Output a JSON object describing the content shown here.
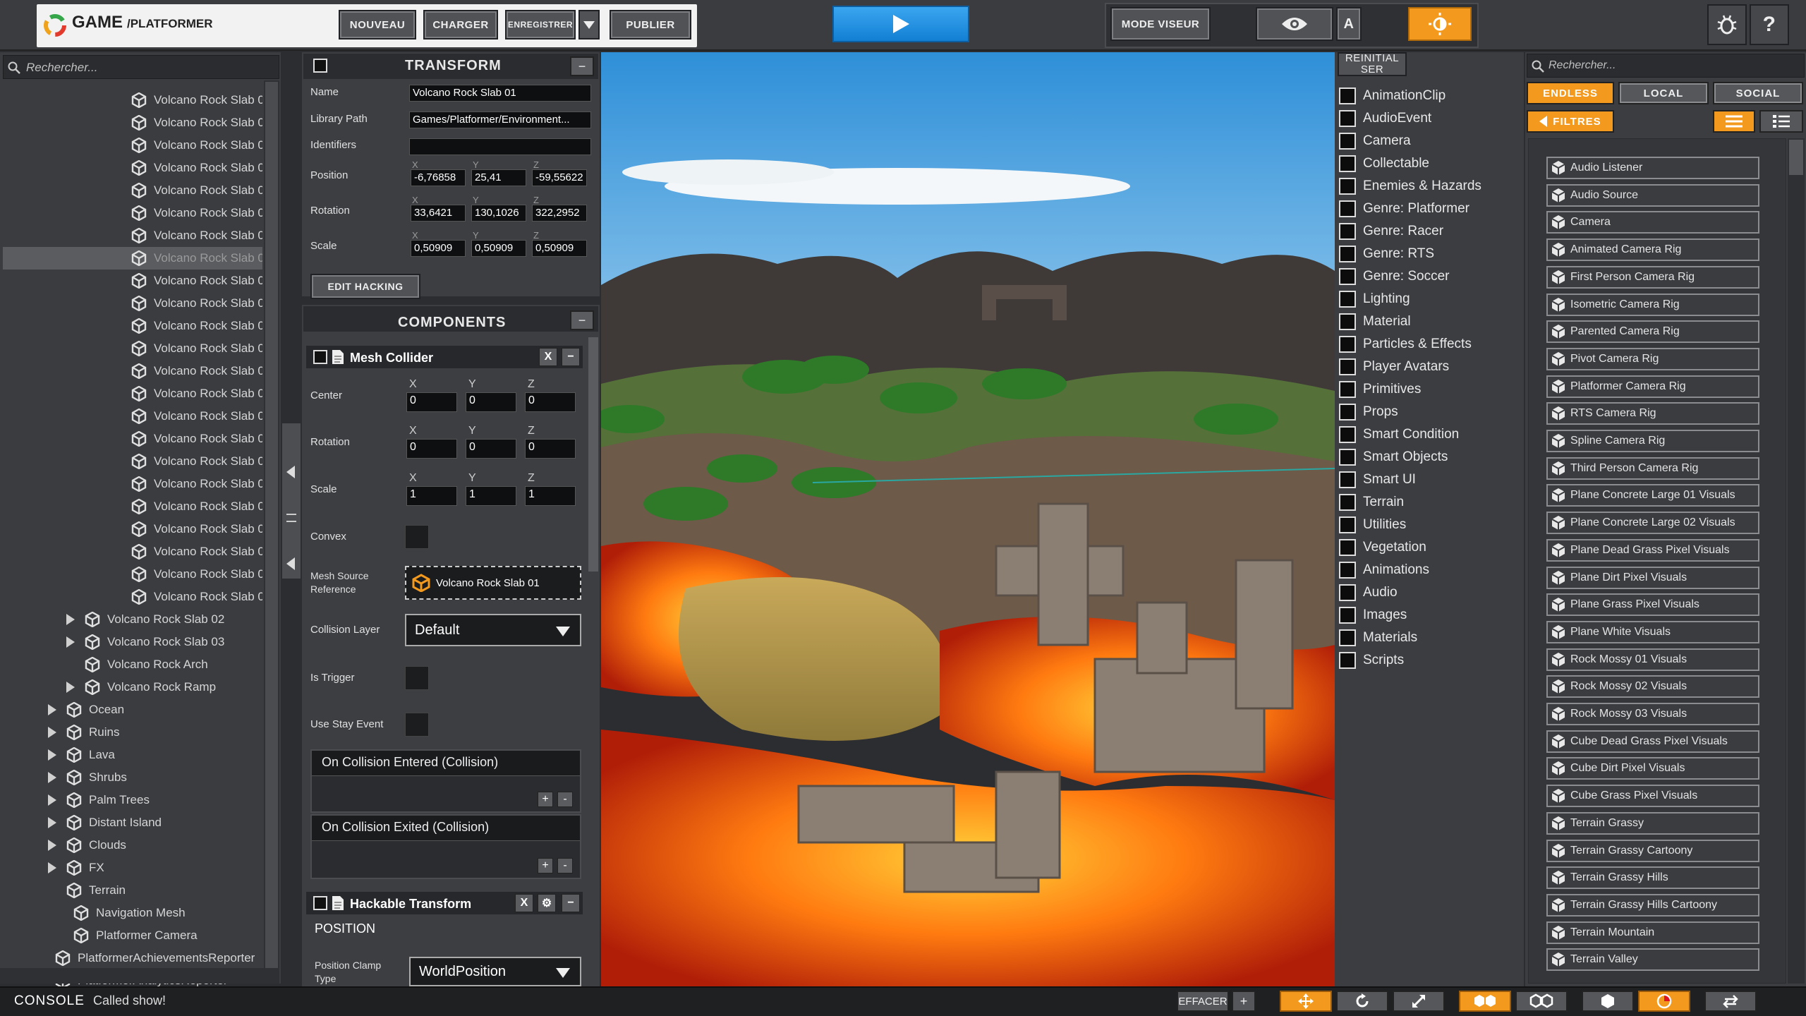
{
  "app": {
    "name": "GAME",
    "subtitle": "/PLATFORMER"
  },
  "toolbar": {
    "nouveau": "NOUVEAU",
    "charger": "CHARGER",
    "enregistrer": "ENREGISTRER",
    "publier": "PUBLIER",
    "mode_viseur": "MODE VISEUR",
    "a_label": "A"
  },
  "colors": {
    "accent_orange": "#f39a1e",
    "play_blue": "#1b8fe0",
    "panel_bg": "#3c3e42"
  },
  "hierarchy": {
    "search_placeholder": "Rechercher...",
    "items": [
      {
        "label": "Volcano Rock Slab 0",
        "level": 2,
        "arrow": false
      },
      {
        "label": "Volcano Rock Slab 0",
        "level": 2,
        "arrow": false
      },
      {
        "label": "Volcano Rock Slab 0",
        "level": 2,
        "arrow": false
      },
      {
        "label": "Volcano Rock Slab 0",
        "level": 2,
        "arrow": false
      },
      {
        "label": "Volcano Rock Slab 0",
        "level": 2,
        "arrow": false
      },
      {
        "label": "Volcano Rock Slab 0",
        "level": 2,
        "arrow": false
      },
      {
        "label": "Volcano Rock Slab 0",
        "level": 2,
        "arrow": false
      },
      {
        "label": "Volcano Rock Slab 0",
        "level": 2,
        "arrow": false,
        "selected": true
      },
      {
        "label": "Volcano Rock Slab 0",
        "level": 2,
        "arrow": false
      },
      {
        "label": "Volcano Rock Slab 0",
        "level": 2,
        "arrow": false
      },
      {
        "label": "Volcano Rock Slab 0",
        "level": 2,
        "arrow": false
      },
      {
        "label": "Volcano Rock Slab 0",
        "level": 2,
        "arrow": false
      },
      {
        "label": "Volcano Rock Slab 0",
        "level": 2,
        "arrow": false
      },
      {
        "label": "Volcano Rock Slab 0",
        "level": 2,
        "arrow": false
      },
      {
        "label": "Volcano Rock Slab 0",
        "level": 2,
        "arrow": false
      },
      {
        "label": "Volcano Rock Slab 0",
        "level": 2,
        "arrow": false
      },
      {
        "label": "Volcano Rock Slab 0",
        "level": 2,
        "arrow": false
      },
      {
        "label": "Volcano Rock Slab 0",
        "level": 2,
        "arrow": false
      },
      {
        "label": "Volcano Rock Slab 0",
        "level": 2,
        "arrow": false
      },
      {
        "label": "Volcano Rock Slab 0",
        "level": 2,
        "arrow": false
      },
      {
        "label": "Volcano Rock Slab 0",
        "level": 2,
        "arrow": false
      },
      {
        "label": "Volcano Rock Slab 0",
        "level": 2,
        "arrow": false
      },
      {
        "label": "Volcano Rock Slab 0",
        "level": 2,
        "arrow": false
      },
      {
        "label": "Volcano Rock Slab 02",
        "level": 1,
        "arrow": true
      },
      {
        "label": "Volcano Rock Slab 03",
        "level": 1,
        "arrow": true
      },
      {
        "label": "Volcano Rock Arch",
        "level": 1,
        "arrow": false
      },
      {
        "label": "Volcano Rock Ramp",
        "level": 1,
        "arrow": true
      },
      {
        "label": "Ocean",
        "level": 0,
        "arrow": true
      },
      {
        "label": "Ruins",
        "level": 0,
        "arrow": true
      },
      {
        "label": "Lava",
        "level": 0,
        "arrow": true
      },
      {
        "label": "Shrubs",
        "level": 0,
        "arrow": true
      },
      {
        "label": "Palm Trees",
        "level": 0,
        "arrow": true
      },
      {
        "label": "Distant Island",
        "level": 0,
        "arrow": true
      },
      {
        "label": "Clouds",
        "level": 0,
        "arrow": true
      },
      {
        "label": "FX",
        "level": 0,
        "arrow": true
      },
      {
        "label": "Terrain",
        "level": 0,
        "arrow": false
      },
      {
        "label": "Navigation Mesh",
        "level": -1,
        "arrow": false
      },
      {
        "label": "Platformer Camera",
        "level": -1,
        "arrow": false
      },
      {
        "label": "PlatformerAchievementsReporter",
        "level": -2,
        "arrow": false
      },
      {
        "label": "PlatformerAnalyticsReporter",
        "level": -2,
        "arrow": false
      }
    ]
  },
  "transform": {
    "title": "TRANSFORM",
    "name_label": "Name",
    "name_value": "Volcano Rock Slab 01",
    "library_label": "Library Path",
    "library_value": "Games/Platformer/Environment...",
    "identifiers_label": "Identifiers",
    "identifiers_value": "",
    "position_label": "Position",
    "rotation_label": "Rotation",
    "scale_label": "Scale",
    "axis_x": "X",
    "axis_y": "Y",
    "axis_z": "Z",
    "position": [
      "-6,76858",
      "25,41",
      "-59,55622"
    ],
    "rotation": [
      "33,6421",
      "130,1026",
      "322,2952"
    ],
    "scale": [
      "0,50909",
      "0,50909",
      "0,50909"
    ],
    "edit_hacking": "EDIT HACKING"
  },
  "components": {
    "title": "COMPONENTS",
    "mesh_collider": {
      "title": "Mesh Collider",
      "x_btn": "X",
      "center_label": "Center",
      "rotation_label": "Rotation",
      "scale_label": "Scale",
      "center": [
        "0",
        "0",
        "0"
      ],
      "rotation": [
        "0",
        "0",
        "0"
      ],
      "scale": [
        "1",
        "1",
        "1"
      ],
      "convex_label": "Convex",
      "mesh_source_label_1": "Mesh Source",
      "mesh_source_label_2": "Reference",
      "mesh_source_value": "Volcano Rock Slab 01",
      "collision_layer_label": "Collision Layer",
      "collision_layer_value": "Default",
      "is_trigger_label": "Is Trigger",
      "use_stay_label": "Use Stay Event",
      "on_enter": "On Collision Entered (Collision)",
      "on_exit": "On Collision Exited (Collision)",
      "plus": "+",
      "minus": "-"
    },
    "hackable": {
      "title": "Hackable Transform",
      "x_btn": "X",
      "position_header": "POSITION",
      "clamp_label_1": "Position Clamp",
      "clamp_label_2": "Type",
      "clamp_value": "WorldPosition"
    }
  },
  "types": {
    "reset_label_1": "REINITIAL",
    "reset_label_2": "SER",
    "items": [
      "AnimationClip",
      "AudioEvent",
      "Camera",
      "Collectable",
      "Enemies & Hazards",
      "Genre: Platformer",
      "Genre: Racer",
      "Genre: RTS",
      "Genre: Soccer",
      "Lighting",
      "Material",
      "Particles & Effects",
      "Player Avatars",
      "Primitives",
      "Props",
      "Smart Condition",
      "Smart Objects",
      "Smart UI",
      "Terrain",
      "Utilities",
      "Vegetation",
      "Animations",
      "Audio",
      "Images",
      "Materials",
      "Scripts"
    ]
  },
  "library": {
    "search_placeholder": "Rechercher...",
    "tab_endless": "ENDLESS",
    "tab_local": "LOCAL",
    "tab_social": "SOCIAL",
    "filters": "FILTRES",
    "items": [
      "Audio Listener",
      "Audio Source",
      "Camera",
      "Animated Camera Rig",
      "First Person Camera Rig",
      "Isometric Camera Rig",
      "Parented Camera Rig",
      "Pivot Camera Rig",
      "Platformer Camera Rig",
      "RTS Camera Rig",
      "Spline Camera Rig",
      "Third Person Camera Rig",
      "Plane Concrete Large 01 Visuals",
      "Plane Concrete Large 02 Visuals",
      "Plane Dead Grass Pixel Visuals",
      "Plane Dirt Pixel Visuals",
      "Plane Grass Pixel Visuals",
      "Plane White Visuals",
      "Rock Mossy 01 Visuals",
      "Rock Mossy 02 Visuals",
      "Rock Mossy 03 Visuals",
      "Cube Dead Grass Pixel Visuals",
      "Cube Dirt Pixel Visuals",
      "Cube Grass Pixel Visuals",
      "Terrain Grassy",
      "Terrain Grassy Cartoony",
      "Terrain Grassy Hills",
      "Terrain Grassy Hills Cartoony",
      "Terrain Mountain",
      "Terrain Valley"
    ]
  },
  "console": {
    "label": "CONSOLE",
    "message": "Called show!",
    "effacer": "EFFACER",
    "plus": "+"
  }
}
